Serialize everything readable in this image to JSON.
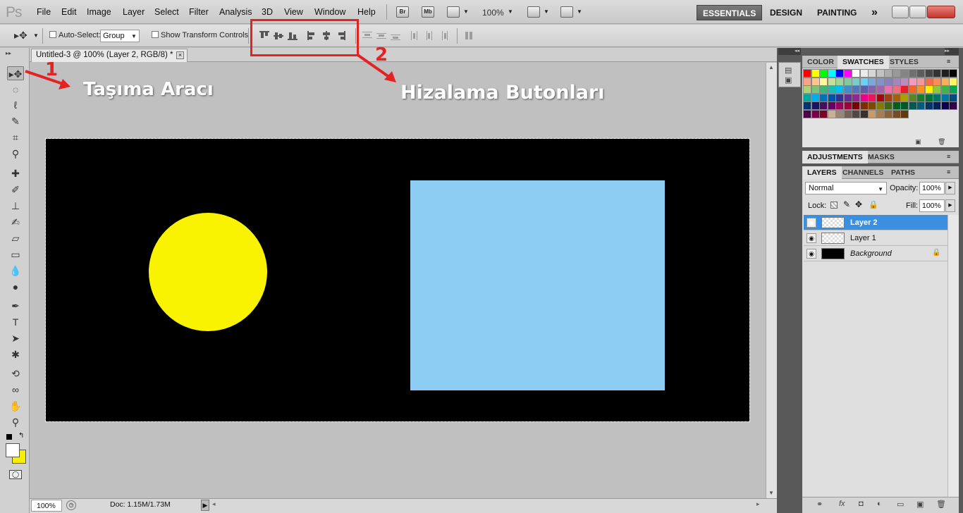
{
  "menubar": {
    "logo": "Ps",
    "items": [
      "File",
      "Edit",
      "Image",
      "Layer",
      "Select",
      "Filter",
      "Analysis",
      "3D",
      "View",
      "Window",
      "Help"
    ],
    "bridge_label": "Br",
    "minibridge_label": "Mb",
    "zoom": "100%",
    "workspaces": [
      "ESSENTIALS",
      "DESIGN",
      "PAINTING"
    ],
    "more": "»"
  },
  "options": {
    "auto_select_label": "Auto-Select:",
    "group_value": "Group",
    "show_transform_label": "Show Transform Controls"
  },
  "document": {
    "tab_title": "Untitled-3 @ 100% (Layer 2, RGB/8) *",
    "close_glyph": "×",
    "colors": {
      "canvas": "#000000",
      "circle": "#f9f200",
      "rectangle": "#8ecdf3"
    }
  },
  "annotations": {
    "num1": "1",
    "label1": "Taşıma Aracı",
    "num2": "2",
    "label2": "Hizalama Butonları",
    "highlight_color": "#e42222"
  },
  "status": {
    "zoom": "100%",
    "doc": "Doc: 1.15M/1.73M"
  },
  "panels": {
    "top_tabs": [
      "COLOR",
      "SWATCHES",
      "STYLES"
    ],
    "mid_tabs": [
      "ADJUSTMENTS",
      "MASKS"
    ],
    "layer_tabs": [
      "LAYERS",
      "CHANNELS",
      "PATHS"
    ]
  },
  "layers": {
    "blend_mode": "Normal",
    "opacity_label": "Opacity:",
    "opacity_value": "100%",
    "lock_label": "Lock:",
    "fill_label": "Fill:",
    "fill_value": "100%",
    "items": [
      {
        "name": "Layer 2",
        "selected": true
      },
      {
        "name": "Layer 1",
        "selected": false
      },
      {
        "name": "Background",
        "selected": false
      }
    ]
  },
  "swatches": [
    "#ff0000",
    "#ffff00",
    "#00ff00",
    "#00ffff",
    "#0000ff",
    "#ff00ff",
    "#ffffff",
    "#ebebeb",
    "#d6d6d6",
    "#c2c2c2",
    "#adadad",
    "#999999",
    "#858585",
    "#707070",
    "#5c5c5c",
    "#474747",
    "#333333",
    "#1f1f1f",
    "#000000",
    "#f7a38a",
    "#fdc68a",
    "#fff799",
    "#c4df9b",
    "#a3d39c",
    "#82ca9c",
    "#7accc8",
    "#6dcff6",
    "#7da7d9",
    "#8393ca",
    "#8781bd",
    "#a187be",
    "#bc8cbf",
    "#f49ac1",
    "#f5989d",
    "#f26c4f",
    "#f68e55",
    "#fbaf5c",
    "#fff467",
    "#acd372",
    "#7cc576",
    "#3bb878",
    "#1abbb4",
    "#00bff3",
    "#438ccb",
    "#5574b9",
    "#605ca8",
    "#855fa8",
    "#a763a8",
    "#f06ea9",
    "#f26d7d",
    "#ed1c24",
    "#f26522",
    "#f7941d",
    "#fff200",
    "#8dc73f",
    "#39b54a",
    "#00a651",
    "#00a99d",
    "#00aeef",
    "#0072bc",
    "#0054a6",
    "#2e3192",
    "#662d91",
    "#92278f",
    "#ec008c",
    "#ed145b",
    "#9e0b0f",
    "#a0410d",
    "#a36209",
    "#aba000",
    "#598527",
    "#1a7b30",
    "#007236",
    "#00746b",
    "#0076a3",
    "#004b80",
    "#003471",
    "#1b1464",
    "#440e62",
    "#630460",
    "#9e005d",
    "#9e0039",
    "#790000",
    "#7b2e00",
    "#7d4900",
    "#827b00",
    "#406618",
    "#005e20",
    "#005826",
    "#005952",
    "#005b7f",
    "#003663",
    "#002157",
    "#0d004c",
    "#32004b",
    "#4b0049",
    "#7b0046",
    "#7a0026",
    "#c7b299",
    "#998675",
    "#736357",
    "#534741",
    "#37302d",
    "#c69c6d",
    "#a67c52",
    "#8c6239",
    "#754c24",
    "#603913"
  ]
}
